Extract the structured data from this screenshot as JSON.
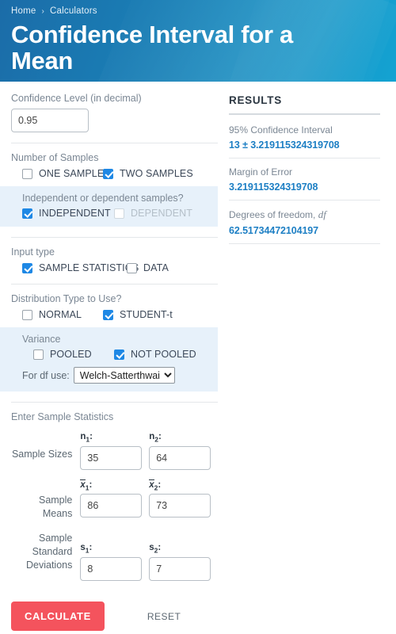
{
  "header": {
    "breadcrumb": {
      "home": "Home",
      "separator": "›",
      "section": "Calculators"
    },
    "title": "Confidence Interval for a Mean",
    "gradient_from": "#1b6ca8",
    "gradient_to": "#14a3d2"
  },
  "form": {
    "confidence": {
      "label": "Confidence Level (in decimal)",
      "value": "0.95"
    },
    "num_samples": {
      "label": "Number of Samples",
      "options": [
        {
          "label": "ONE SAMPLE",
          "checked": false,
          "disabled": false
        },
        {
          "label": "TWO SAMPLES",
          "checked": true,
          "disabled": false
        }
      ]
    },
    "independence": {
      "label": "Independent or dependent samples?",
      "options": [
        {
          "label": "INDEPENDENT",
          "checked": true,
          "disabled": false
        },
        {
          "label": "DEPENDENT",
          "checked": false,
          "disabled": true
        }
      ]
    },
    "input_type": {
      "label": "Input type",
      "options": [
        {
          "label": "SAMPLE STATISTICS",
          "checked": true,
          "disabled": false
        },
        {
          "label": "DATA",
          "checked": false,
          "disabled": false
        }
      ]
    },
    "distribution": {
      "label": "Distribution Type to Use?",
      "options": [
        {
          "label": "NORMAL",
          "checked": false,
          "disabled": false
        },
        {
          "label": "STUDENT-t",
          "checked": true,
          "disabled": false
        }
      ]
    },
    "variance": {
      "label": "Variance",
      "options": [
        {
          "label": "POOLED",
          "checked": false,
          "disabled": false
        },
        {
          "label": "NOT POOLED",
          "checked": true,
          "disabled": false
        }
      ],
      "df_label": "For df use:",
      "df_selected": "Welch-Satterthwaite",
      "df_options": [
        "Welch-Satterthwaite"
      ]
    },
    "sample_stats": {
      "title": "Enter Sample Statistics",
      "rows": [
        {
          "name_lines": [
            "Sample Sizes"
          ],
          "sym1": "n",
          "sub1": "1",
          "sym2": "n",
          "sub2": "2",
          "overline": false,
          "value1": "35",
          "value2": "64"
        },
        {
          "name_lines": [
            "Sample",
            "Means"
          ],
          "sym1": "x",
          "sub1": "1",
          "sym2": "x",
          "sub2": "2",
          "overline": true,
          "value1": "86",
          "value2": "73"
        },
        {
          "name_lines": [
            "Sample",
            "Standard",
            "Deviations"
          ],
          "sym1": "s",
          "sub1": "1",
          "sym2": "s",
          "sub2": "2",
          "overline": false,
          "value1": "8",
          "value2": "7"
        }
      ],
      "colon": ":"
    },
    "actions": {
      "calculate": "CALCULATE",
      "reset": "RESET",
      "calculate_color": "#f4535d"
    }
  },
  "results": {
    "title": "RESULTS",
    "accent_color": "#1d7fc4",
    "items": [
      {
        "label": "95% Confidence Interval",
        "value": "13 ± 3.219115324319708",
        "italic_df": ""
      },
      {
        "label": "Margin of Error",
        "value": "3.219115324319708",
        "italic_df": ""
      },
      {
        "label": "Degrees of freedom, ",
        "value": "62.51734472104197",
        "italic_df": "df"
      }
    ]
  }
}
